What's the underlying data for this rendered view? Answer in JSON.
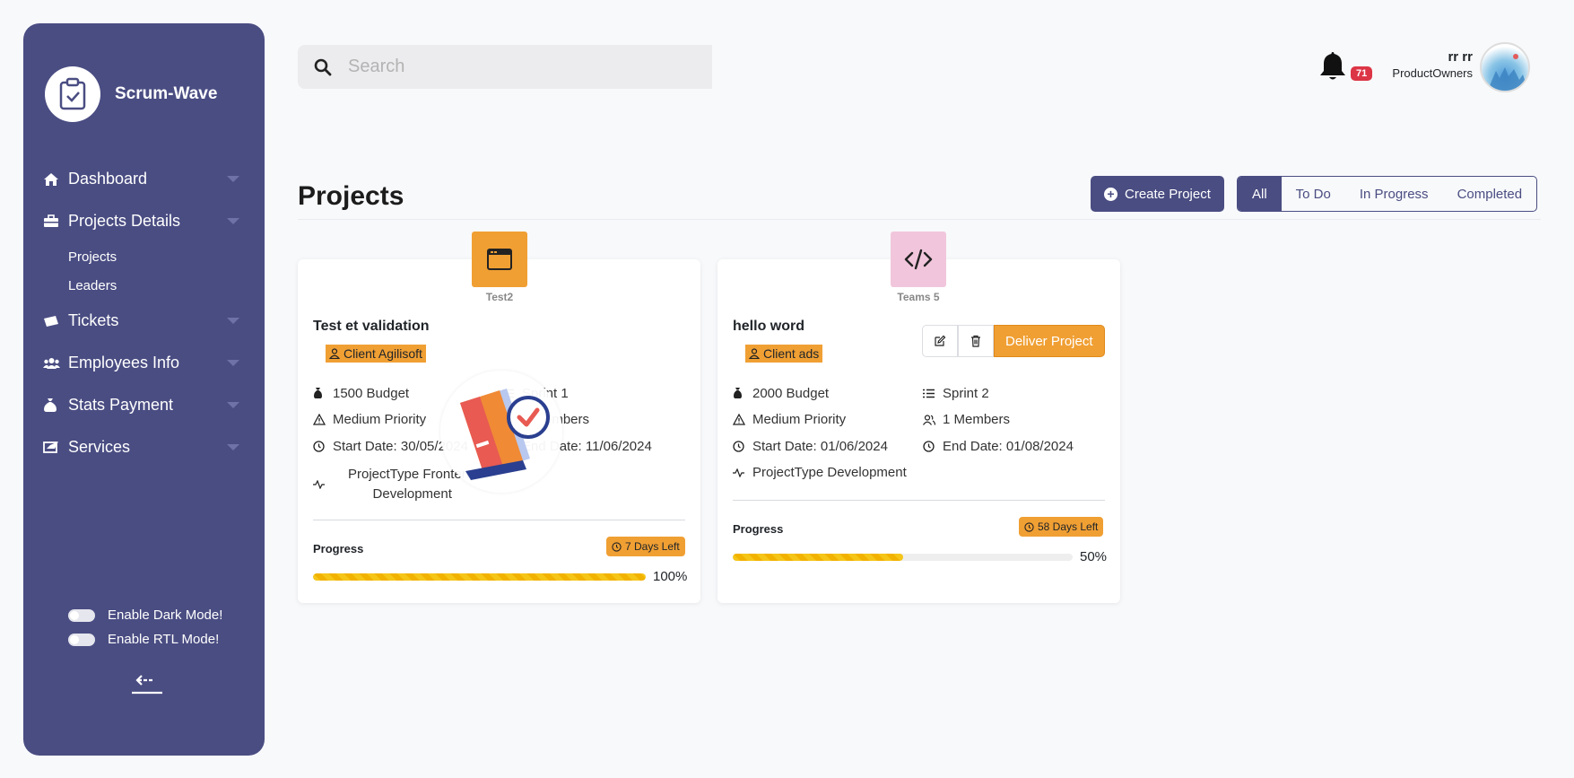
{
  "sidebar": {
    "brand": "Scrum-Wave",
    "items": [
      {
        "label": "Dashboard",
        "icon": "home-icon"
      },
      {
        "label": "Projects Details",
        "icon": "briefcase-icon"
      },
      {
        "label": "Tickets",
        "icon": "ticket-icon"
      },
      {
        "label": "Employees Info",
        "icon": "users-icon"
      },
      {
        "label": "Stats Payment",
        "icon": "money-bag-icon"
      },
      {
        "label": "Services",
        "icon": "services-icon"
      }
    ],
    "sub_items": [
      "Projects",
      "Leaders"
    ],
    "toggles": [
      "Enable Dark Mode!",
      "Enable RTL Mode!"
    ]
  },
  "search": {
    "placeholder": "Search"
  },
  "notifications": {
    "count": "71"
  },
  "user": {
    "name": "rr rr",
    "role": "ProductOwners"
  },
  "page": {
    "title": "Projects",
    "create_label": "Create Project",
    "filters": [
      "All",
      "To Do",
      "In Progress",
      "Completed"
    ],
    "active_filter": "All"
  },
  "projects": [
    {
      "team": "Test2",
      "title": "Test et validation",
      "client": "Client Agilisoft",
      "budget": "1500 Budget",
      "sprint": "Sprint 1",
      "priority": "Medium Priority",
      "members": "1 Members",
      "start": "Start Date: 30/05/2024",
      "end": "End Date: 11/06/2024",
      "type_line1": "ProjectType Frontend",
      "type_line2": "Development",
      "progress_label": "Progress",
      "days_left": "7 Days Left",
      "progress": 100,
      "progress_text": "100%",
      "icon_color": "#f09f33"
    },
    {
      "team": "Teams 5",
      "title": "hello word",
      "client": "Client ads",
      "budget": "2000 Budget",
      "sprint": "Sprint 2",
      "priority": "Medium Priority",
      "members": "1 Members",
      "start": "Start Date: 01/06/2024",
      "end": "End Date: 01/08/2024",
      "type_line1": "ProjectType Development",
      "progress_label": "Progress",
      "days_left": "58 Days Left",
      "progress": 50,
      "progress_text": "50%",
      "deliver_label": "Deliver Project",
      "icon_color": "#f1c6dc"
    }
  ],
  "colors": {
    "primary": "#4a4d82",
    "accent": "#f09f33",
    "danger": "#dc3545"
  }
}
